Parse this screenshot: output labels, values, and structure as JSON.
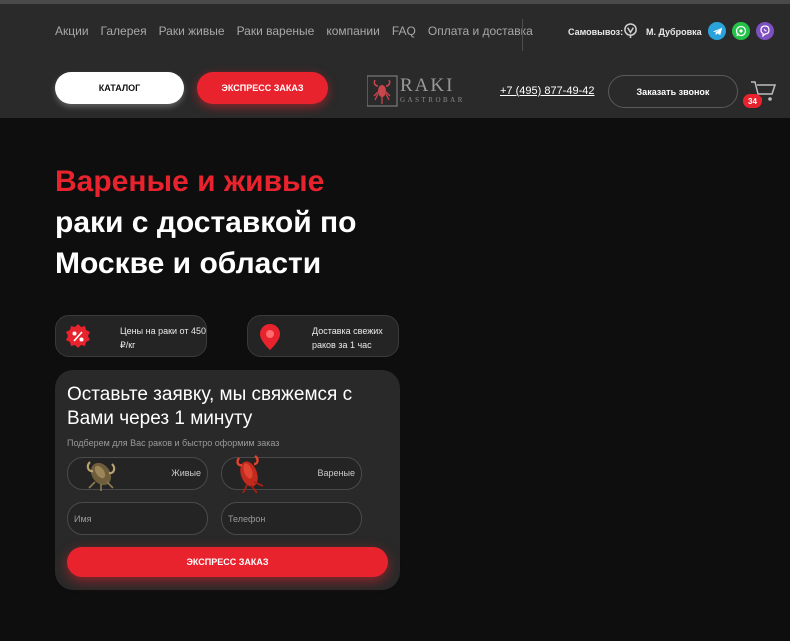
{
  "nav": {
    "items": [
      "Акции",
      "Галерея",
      "Раки живые",
      "Раки вареные",
      "компании",
      "FAQ",
      "Оплата и доставка"
    ]
  },
  "header": {
    "pickup_label": "Самовывоз:",
    "metro": "М. Дубровка",
    "catalog_label": "КАТАЛОГ",
    "express_label": "ЭКСПРЕСС ЗАКАЗ",
    "logo_name": "RAKI",
    "logo_sub": "GASTROBAR",
    "phone": "+7 (495) 877-49-42",
    "call_label": "Заказать звонок",
    "cart_count": "34"
  },
  "hero": {
    "title_red": "Вареные и живые",
    "title_white": "раки с доставкой по Москве и области"
  },
  "features": [
    {
      "text": "Цены на раки от 450 ₽/кг",
      "icon": "percent-badge-icon"
    },
    {
      "text": "Доставка свежих раков за 1 час",
      "icon": "location-pin-icon"
    }
  ],
  "form": {
    "title": "Оставьте заявку, мы свяжемся с Вами через 1 минуту",
    "subtitle": "Подберем для Вас раков и быстро оформим заказ",
    "option_live": "Живые",
    "option_boiled": "Вареные",
    "name_placeholder": "Имя",
    "phone_placeholder": "Телефон",
    "submit_label": "ЭКСПРЕСС ЗАКАЗ"
  },
  "colors": {
    "accent": "#e8232d",
    "header_bg": "#2a2a2a",
    "page_bg": "#0e0e0e",
    "telegram": "#2aa3dd",
    "whatsapp": "#25c24a",
    "viber": "#7d4fc1"
  }
}
